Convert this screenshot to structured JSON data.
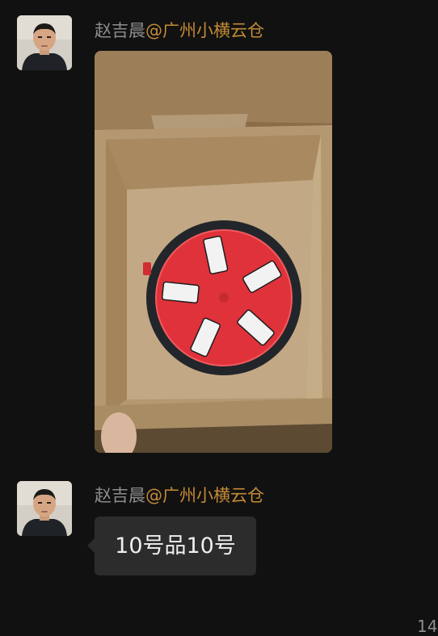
{
  "messages": [
    {
      "sender_name": "赵吉晨",
      "sender_org": "@广州小横云仓",
      "type": "image"
    },
    {
      "sender_name": "赵吉晨",
      "sender_org": "@广州小横云仓",
      "type": "text",
      "text": "10号品10号"
    }
  ],
  "timestamp_partial": "14",
  "colors": {
    "background": "#111111",
    "sender_name": "#8d8d8d",
    "sender_org": "#c48a36",
    "bubble": "#2c2c2c",
    "bubble_text": "#efefef"
  },
  "icons": [
    "avatar",
    "photo-thumbnail"
  ]
}
